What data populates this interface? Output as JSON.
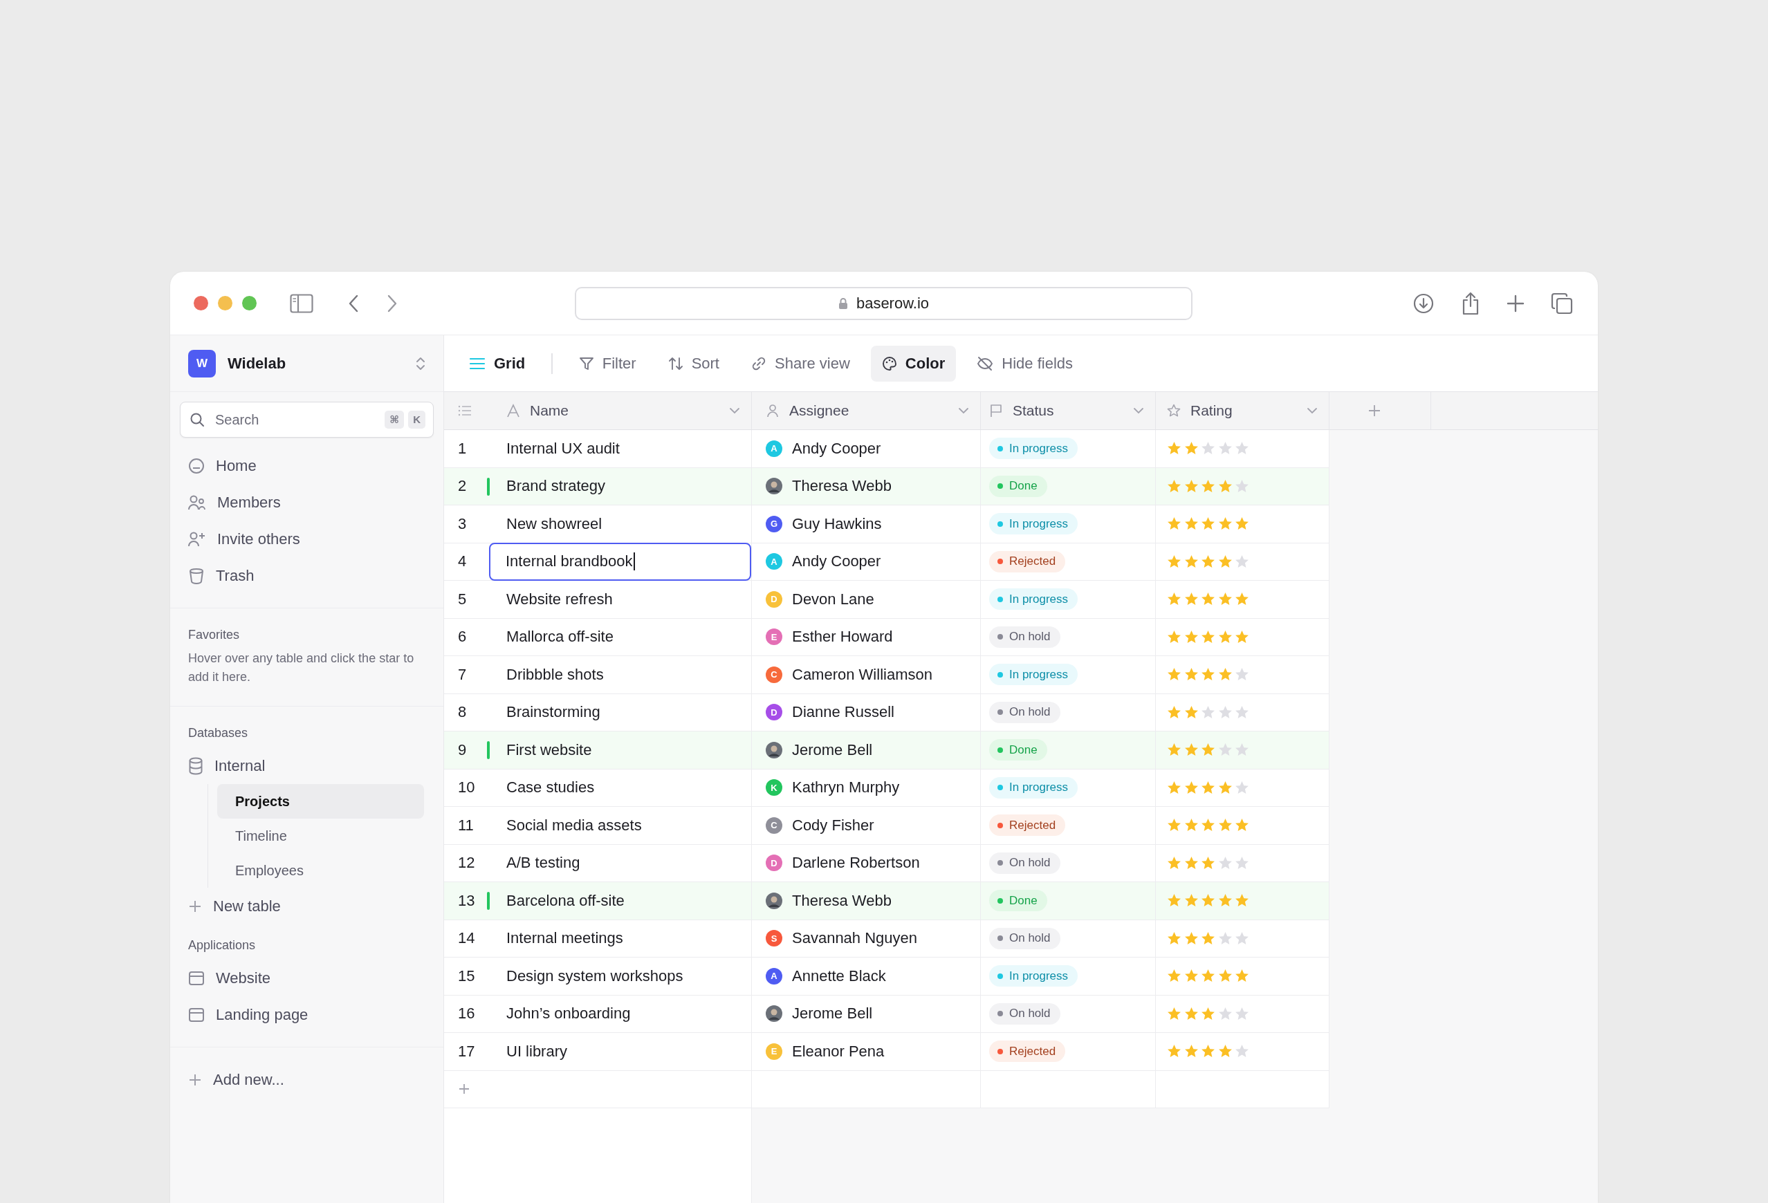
{
  "browser": {
    "address": "baserow.io"
  },
  "sidebar": {
    "workspace": {
      "initial": "W",
      "name": "Widelab"
    },
    "search": {
      "placeholder": "Search",
      "shortcut": [
        "⌘",
        "K"
      ]
    },
    "nav": [
      {
        "label": "Home"
      },
      {
        "label": "Members"
      },
      {
        "label": "Invite others"
      },
      {
        "label": "Trash"
      }
    ],
    "favorites": {
      "title": "Favorites",
      "hint": "Hover over any table and click the star to add it here."
    },
    "databases": {
      "title": "Databases",
      "items": [
        {
          "label": "Internal",
          "children": [
            {
              "label": "Projects",
              "selected": true
            },
            {
              "label": "Timeline",
              "selected": false
            },
            {
              "label": "Employees",
              "selected": false
            }
          ]
        }
      ],
      "new_table": "New table"
    },
    "applications": {
      "title": "Applications",
      "items": [
        {
          "label": "Website"
        },
        {
          "label": "Landing page"
        }
      ]
    },
    "add_new": "Add new..."
  },
  "toolbar": {
    "view": "Grid",
    "buttons": [
      {
        "label": "Filter",
        "active": false
      },
      {
        "label": "Sort",
        "active": false
      },
      {
        "label": "Share view",
        "active": false
      },
      {
        "label": "Color",
        "active": true
      },
      {
        "label": "Hide fields",
        "active": false
      }
    ]
  },
  "table": {
    "columns": [
      {
        "label": "Name"
      },
      {
        "label": "Assignee"
      },
      {
        "label": "Status"
      },
      {
        "label": "Rating"
      }
    ],
    "rows": [
      {
        "number": "1",
        "name": "Internal UX audit",
        "highlighted": false,
        "editing": false,
        "assignee": {
          "kind": "letter",
          "initial": "A",
          "color": "#1ec8e1",
          "name": "Andy Cooper"
        },
        "status": {
          "kind": "in_progress",
          "label": "In progress"
        },
        "stars": 2
      },
      {
        "number": "2",
        "name": "Brand strategy",
        "highlighted": true,
        "editing": false,
        "assignee": {
          "kind": "photo",
          "name": "Theresa Webb"
        },
        "status": {
          "kind": "done",
          "label": "Done"
        },
        "stars": 4
      },
      {
        "number": "3",
        "name": "New showreel",
        "highlighted": false,
        "editing": false,
        "assignee": {
          "kind": "letter",
          "initial": "G",
          "color": "#4f5cf2",
          "name": "Guy Hawkins"
        },
        "status": {
          "kind": "in_progress",
          "label": "In progress"
        },
        "stars": 5
      },
      {
        "number": "4",
        "name": "Internal brandbook",
        "highlighted": false,
        "editing": true,
        "assignee": {
          "kind": "letter",
          "initial": "A",
          "color": "#1ec8e1",
          "name": "Andy Cooper"
        },
        "status": {
          "kind": "rejected",
          "label": "Rejected"
        },
        "stars": 4
      },
      {
        "number": "5",
        "name": "Website refresh",
        "highlighted": false,
        "editing": false,
        "assignee": {
          "kind": "letter",
          "initial": "D",
          "color": "#f8c13a",
          "name": "Devon Lane"
        },
        "status": {
          "kind": "in_progress",
          "label": "In progress"
        },
        "stars": 5
      },
      {
        "number": "6",
        "name": "Mallorca off-site",
        "highlighted": false,
        "editing": false,
        "assignee": {
          "kind": "letter",
          "initial": "E",
          "color": "#e46fb5",
          "name": "Esther Howard"
        },
        "status": {
          "kind": "on_hold",
          "label": "On hold"
        },
        "stars": 5
      },
      {
        "number": "7",
        "name": "Dribbble shots",
        "highlighted": false,
        "editing": false,
        "assignee": {
          "kind": "letter",
          "initial": "C",
          "color": "#f76a3c",
          "name": "Cameron Williamson"
        },
        "status": {
          "kind": "in_progress",
          "label": "In progress"
        },
        "stars": 4
      },
      {
        "number": "8",
        "name": "Brainstorming",
        "highlighted": false,
        "editing": false,
        "assignee": {
          "kind": "letter",
          "initial": "D",
          "color": "#a64ee8",
          "name": "Dianne Russell"
        },
        "status": {
          "kind": "on_hold",
          "label": "On hold"
        },
        "stars": 2
      },
      {
        "number": "9",
        "name": "First website",
        "highlighted": true,
        "editing": false,
        "assignee": {
          "kind": "photo",
          "name": "Jerome Bell"
        },
        "status": {
          "kind": "done",
          "label": "Done"
        },
        "stars": 3
      },
      {
        "number": "10",
        "name": "Case studies",
        "highlighted": false,
        "editing": false,
        "assignee": {
          "kind": "letter",
          "initial": "K",
          "color": "#22c55e",
          "name": "Kathryn Murphy"
        },
        "status": {
          "kind": "in_progress",
          "label": "In progress"
        },
        "stars": 4
      },
      {
        "number": "11",
        "name": "Social media assets",
        "highlighted": false,
        "editing": false,
        "assignee": {
          "kind": "letter",
          "initial": "C",
          "color": "#8f8f99",
          "name": "Cody Fisher"
        },
        "status": {
          "kind": "rejected",
          "label": "Rejected"
        },
        "stars": 5
      },
      {
        "number": "12",
        "name": "A/B testing",
        "highlighted": false,
        "editing": false,
        "assignee": {
          "kind": "letter",
          "initial": "D",
          "color": "#e46fb5",
          "name": "Darlene Robertson"
        },
        "status": {
          "kind": "on_hold",
          "label": "On hold"
        },
        "stars": 3
      },
      {
        "number": "13",
        "name": "Barcelona off-site",
        "highlighted": true,
        "editing": false,
        "assignee": {
          "kind": "photo",
          "name": "Theresa Webb"
        },
        "status": {
          "kind": "done",
          "label": "Done"
        },
        "stars": 5
      },
      {
        "number": "14",
        "name": "Internal meetings",
        "highlighted": false,
        "editing": false,
        "assignee": {
          "kind": "letter",
          "initial": "S",
          "color": "#f7583c",
          "name": "Savannah Nguyen"
        },
        "status": {
          "kind": "on_hold",
          "label": "On hold"
        },
        "stars": 3
      },
      {
        "number": "15",
        "name": "Design system workshops",
        "highlighted": false,
        "editing": false,
        "assignee": {
          "kind": "letter",
          "initial": "A",
          "color": "#4f5cf2",
          "name": "Annette Black"
        },
        "status": {
          "kind": "in_progress",
          "label": "In progress"
        },
        "stars": 5
      },
      {
        "number": "16",
        "name": "John’s onboarding",
        "highlighted": false,
        "editing": false,
        "assignee": {
          "kind": "photo",
          "name": "Jerome Bell"
        },
        "status": {
          "kind": "on_hold",
          "label": "On hold"
        },
        "stars": 3
      },
      {
        "number": "17",
        "name": "UI library",
        "highlighted": false,
        "editing": false,
        "assignee": {
          "kind": "letter",
          "initial": "E",
          "color": "#f8c13a",
          "name": "Eleanor Pena"
        },
        "status": {
          "kind": "rejected",
          "label": "Rejected"
        },
        "stars": 4
      }
    ]
  }
}
